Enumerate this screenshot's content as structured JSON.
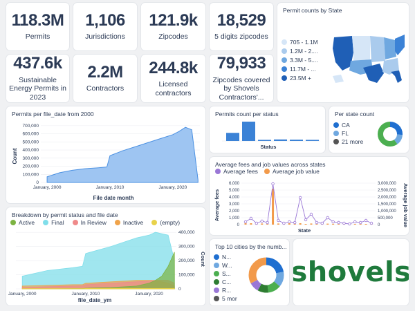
{
  "kpis": [
    {
      "value": "118.3M",
      "label": "Permits"
    },
    {
      "value": "1,106",
      "label": "Jurisdictions"
    },
    {
      "value": "121.9k",
      "label": "Zipcodes"
    },
    {
      "value": "18,529",
      "label": "5 digits zipcodes"
    },
    {
      "value": "437.6k",
      "label": "Sustainable Energy Permits in 2023"
    },
    {
      "value": "2.2M",
      "label": "Contractors"
    },
    {
      "value": "244.8k",
      "label": "Licensed contractors"
    },
    {
      "value": "79,933",
      "label": "Zipcodes covered by Shovels Contractors'..."
    }
  ],
  "map": {
    "title": "Permit counts by State",
    "legend": [
      {
        "label": "705 - 1.1M",
        "color": "#d6e6f7"
      },
      {
        "label": "1.2M - 2....",
        "color": "#aacbed"
      },
      {
        "label": "3.3M - 5....",
        "color": "#6fa8e0"
      },
      {
        "label": "11.7M - ...",
        "color": "#3b82d6"
      },
      {
        "label": "23.5M +",
        "color": "#1f5fb6"
      }
    ]
  },
  "file_date": {
    "title": "Permits per file_date from 2000",
    "xlabel": "File date month",
    "ylabel": "Count"
  },
  "status": {
    "title": "Permits count per status",
    "xlabel": "Status"
  },
  "per_state": {
    "title": "Per state count",
    "legend": [
      {
        "label": "CA",
        "color": "#1f6fd0"
      },
      {
        "label": "FL",
        "color": "#6fa8e0"
      },
      {
        "label": "21 more",
        "color": "#555555"
      }
    ]
  },
  "fees": {
    "title": "Average fees and job values across states",
    "legend": [
      {
        "label": "Average fees",
        "color": "#9a77d6"
      },
      {
        "label": "Average job value",
        "color": "#f29a4a"
      }
    ],
    "xlabel": "State",
    "ylabel_left": "Average fees",
    "ylabel_right": "Average job value"
  },
  "breakdown": {
    "title": "Breakdown by permit status and file date",
    "legend": [
      {
        "label": "Active",
        "color": "#7cb342"
      },
      {
        "label": "Final",
        "color": "#80deea"
      },
      {
        "label": "In Review",
        "color": "#ef8a8a"
      },
      {
        "label": "Inactive",
        "color": "#f0a34a"
      },
      {
        "label": "(empty)",
        "color": "#e8d24a"
      }
    ],
    "xlabel": "file_date_ym",
    "ylabel": "Count"
  },
  "cities": {
    "title": "Top 10 cities by the numb...",
    "legend": [
      {
        "label": "N...",
        "color": "#1f6fd0"
      },
      {
        "label": "W...",
        "color": "#6fa8e0"
      },
      {
        "label": "S...",
        "color": "#4caf50"
      },
      {
        "label": "C...",
        "color": "#2e7d32"
      },
      {
        "label": "R...",
        "color": "#9a77d6"
      },
      {
        "label": "5 mor",
        "color": "#555555"
      }
    ]
  },
  "logo": {
    "text": "shovels"
  },
  "chart_data": [
    {
      "type": "area",
      "title": "Permits per file_date from 2000",
      "xlabel": "File date month",
      "ylabel": "Count",
      "x_ticks": [
        "January, 2000",
        "January, 2010",
        "January, 2020"
      ],
      "y_ticks": [
        "0",
        "100,000",
        "200,000",
        "300,000",
        "400,000",
        "500,000",
        "600,000",
        "700,000"
      ],
      "ylim": [
        0,
        750000
      ],
      "x": [
        2000,
        2002,
        2004,
        2006,
        2008,
        2009.5,
        2010,
        2012,
        2014,
        2016,
        2018,
        2020,
        2021,
        2022,
        2023,
        2024
      ],
      "values": [
        70000,
        120000,
        150000,
        170000,
        180000,
        190000,
        330000,
        390000,
        440000,
        490000,
        540000,
        590000,
        630000,
        680000,
        650000,
        30000
      ],
      "color": "#4a90e2"
    },
    {
      "type": "bar",
      "title": "Permits count per status",
      "xlabel": "Status",
      "values": [
        42,
        100,
        6,
        8,
        7,
        6
      ],
      "color": "#3b82d6"
    },
    {
      "type": "pie",
      "title": "Per state count",
      "categories": [
        "CA",
        "FL",
        "21 more"
      ],
      "values": [
        26,
        14,
        60
      ],
      "colors": [
        "#1f6fd0",
        "#6fa8e0",
        "#4caf50",
        "#2e7d32",
        "#f29a4a",
        "#e8d24a",
        "#9a77d6",
        "#ef8a8a",
        "#555555"
      ]
    },
    {
      "type": "line",
      "title": "Average fees and job values across states",
      "xlabel": "State",
      "y_ticks_left": [
        "0",
        "1,000",
        "2,000",
        "3,000",
        "4,000",
        "5,000",
        "6,000"
      ],
      "y_ticks_right": [
        "0",
        "500,000",
        "1,000,000",
        "1,500,000",
        "2,000,000",
        "2,500,000",
        "3,000,000"
      ],
      "series": [
        {
          "name": "Average fees",
          "axis": "left",
          "values": [
            400,
            900,
            200,
            500,
            300,
            5900,
            600,
            200,
            400,
            300,
            3900,
            700,
            1500,
            300,
            200,
            1000,
            400,
            300,
            200,
            100,
            400,
            300,
            600,
            200
          ]
        },
        {
          "name": "Average job value",
          "axis": "right",
          "values": [
            100000,
            100000,
            50000,
            80000,
            100000,
            2600000,
            80000,
            60000,
            100000,
            70000,
            100000,
            50000,
            80000,
            60000,
            50000,
            70000,
            60000,
            50000,
            60000,
            40000,
            50000,
            60000,
            50000,
            40000
          ]
        }
      ]
    },
    {
      "type": "area",
      "title": "Breakdown by permit status and file date",
      "xlabel": "file_date_ym",
      "ylabel": "Count",
      "x_ticks": [
        "January, 2000",
        "January, 2010",
        "January, 2020"
      ],
      "y_ticks": [
        "0",
        "100,000",
        "200,000",
        "300,000",
        "400,000"
      ],
      "ylim": [
        0,
        430000
      ],
      "x": [
        2000,
        2004,
        2008,
        2009.5,
        2010,
        2014,
        2018,
        2020,
        2021,
        2022,
        2023,
        2024
      ],
      "series": [
        {
          "name": "Active",
          "values": [
            0,
            0,
            2000,
            2000,
            5000,
            10000,
            20000,
            40000,
            60000,
            90000,
            160000,
            260000
          ]
        },
        {
          "name": "Final",
          "values": [
            90000,
            130000,
            150000,
            160000,
            250000,
            300000,
            360000,
            380000,
            400000,
            390000,
            380000,
            200000
          ]
        },
        {
          "name": "In Review",
          "values": [
            10000,
            15000,
            20000,
            22000,
            30000,
            40000,
            50000,
            55000,
            60000,
            60000,
            60000,
            40000
          ]
        },
        {
          "name": "Inactive",
          "values": [
            20000,
            25000,
            30000,
            30000,
            40000,
            50000,
            60000,
            60000,
            60000,
            50000,
            40000,
            20000
          ]
        },
        {
          "name": "(empty)",
          "values": [
            2000,
            2000,
            2000,
            2000,
            3000,
            3000,
            3000,
            3000,
            3000,
            3000,
            3000,
            3000
          ]
        }
      ]
    },
    {
      "type": "pie",
      "title": "Top 10 cities by the numb...",
      "categories": [
        "N...",
        "W...",
        "S...",
        "C...",
        "R...",
        "5 mor"
      ],
      "values": [
        22,
        14,
        12,
        10,
        9,
        33
      ],
      "colors": [
        "#1f6fd0",
        "#6fa8e0",
        "#4caf50",
        "#2e7d32",
        "#9a77d6",
        "#f29a4a",
        "#e8d24a",
        "#ef8a8a",
        "#80deea",
        "#555555"
      ]
    }
  ]
}
